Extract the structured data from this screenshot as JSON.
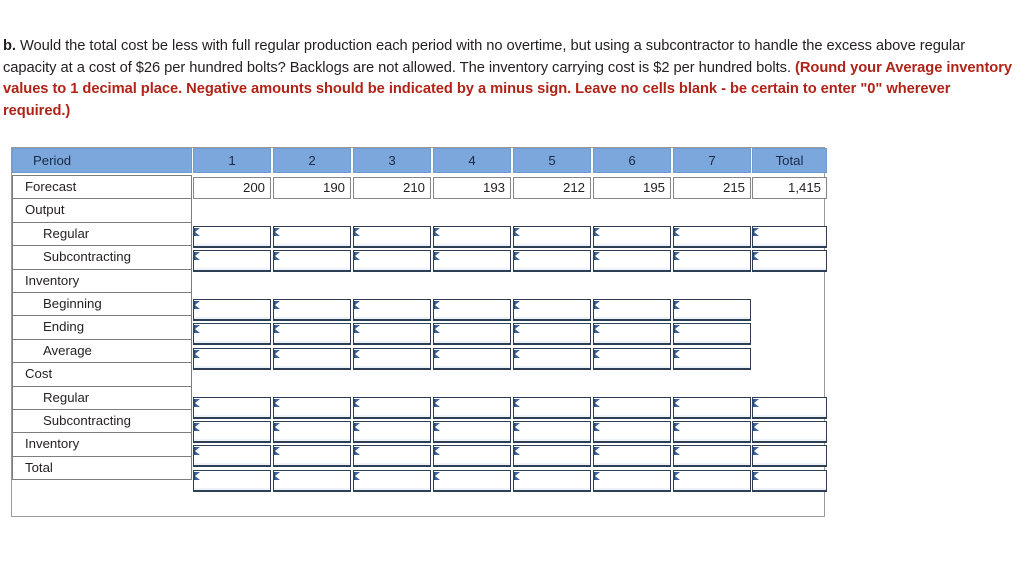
{
  "question": {
    "label": "b.",
    "body_1": " Would the total cost be less with full regular production each period with no overtime, but using a subcontractor to handle the excess above regular capacity at a cost of $26 per hundred bolts? Backlogs are not allowed. The inventory carrying cost is $2 per hundred bolts. ",
    "instruction": "(Round your Average inventory values to 1 decimal place. Negative amounts should be indicated by a minus sign. Leave no cells blank - be certain to enter \"0\" wherever required.)"
  },
  "colors": {
    "header_blue": "#7ba7dd",
    "instruction_red": "#b02318",
    "input_border": "#2d3e55",
    "flag_blue": "#3d6295"
  },
  "table": {
    "corner_label": "Period",
    "period_headers": [
      "1",
      "2",
      "3",
      "4",
      "5",
      "6",
      "7"
    ],
    "total_header": "Total",
    "rows": [
      {
        "label": "Forecast",
        "indent": false,
        "type": "value"
      },
      {
        "label": "Output",
        "indent": false,
        "type": "section"
      },
      {
        "label": "Regular",
        "indent": true,
        "type": "input"
      },
      {
        "label": "Subcontracting",
        "indent": true,
        "type": "input"
      },
      {
        "label": "Inventory",
        "indent": false,
        "type": "section"
      },
      {
        "label": "Beginning",
        "indent": true,
        "type": "input"
      },
      {
        "label": "Ending",
        "indent": true,
        "type": "input"
      },
      {
        "label": "Average",
        "indent": true,
        "type": "input"
      },
      {
        "label": "Cost",
        "indent": false,
        "type": "section"
      },
      {
        "label": "Regular",
        "indent": true,
        "type": "input"
      },
      {
        "label": "Subcontracting",
        "indent": true,
        "type": "input"
      },
      {
        "label": "Inventory",
        "indent": false,
        "type": "input"
      },
      {
        "label": "Total",
        "indent": false,
        "type": "input"
      }
    ],
    "forecast": {
      "values": [
        "200",
        "190",
        "210",
        "193",
        "212",
        "195",
        "215"
      ],
      "total": "1,415"
    },
    "output_group": {
      "row_labels": [
        "Regular",
        "Subcontracting"
      ],
      "values": [
        [
          "",
          "",
          "",
          "",
          "",
          "",
          ""
        ],
        [
          "",
          "",
          "",
          "",
          "",
          "",
          ""
        ]
      ],
      "totals": [
        "",
        ""
      ]
    },
    "inventory_group": {
      "row_labels": [
        "Beginning",
        "Ending",
        "Average"
      ],
      "values": [
        [
          "",
          "",
          "",
          "",
          "",
          "",
          ""
        ],
        [
          "",
          "",
          "",
          "",
          "",
          "",
          ""
        ],
        [
          "",
          "",
          "",
          "",
          "",
          "",
          ""
        ]
      ]
    },
    "cost_group": {
      "row_labels": [
        "Regular",
        "Subcontracting",
        "Inventory",
        "Total"
      ],
      "values": [
        [
          "",
          "",
          "",
          "",
          "",
          "",
          ""
        ],
        [
          "",
          "",
          "",
          "",
          "",
          "",
          ""
        ],
        [
          "",
          "",
          "",
          "",
          "",
          "",
          ""
        ],
        [
          "",
          "",
          "",
          "",
          "",
          "",
          ""
        ]
      ],
      "totals": [
        "",
        "",
        "",
        ""
      ]
    }
  }
}
